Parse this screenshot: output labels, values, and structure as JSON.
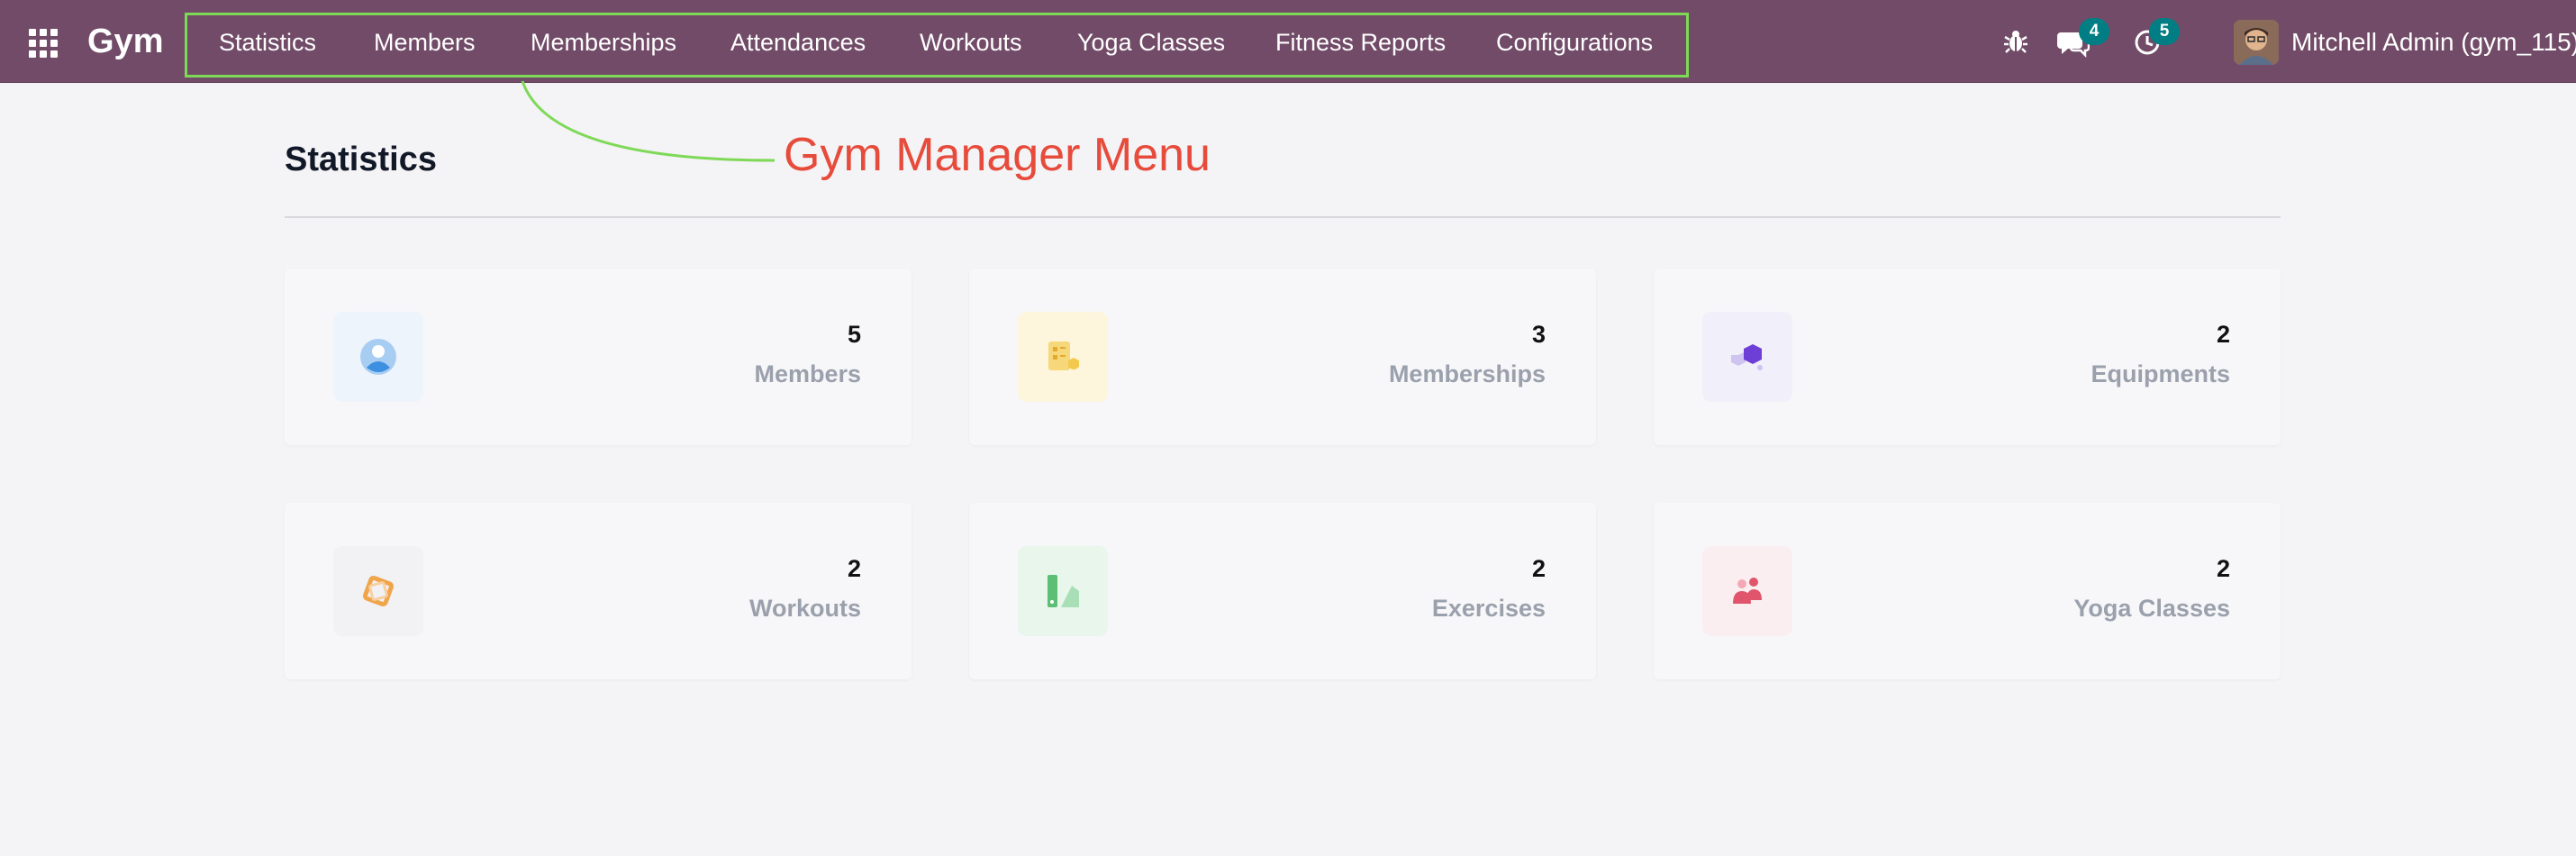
{
  "topbar": {
    "brand": "Gym",
    "menu": [
      {
        "id": "statistics",
        "label": "Statistics"
      },
      {
        "id": "members",
        "label": "Members"
      },
      {
        "id": "memberships",
        "label": "Memberships"
      },
      {
        "id": "attendances",
        "label": "Attendances"
      },
      {
        "id": "workouts",
        "label": "Workouts"
      },
      {
        "id": "yoga-classes",
        "label": "Yoga Classes"
      },
      {
        "id": "fitness-reports",
        "label": "Fitness Reports"
      },
      {
        "id": "configurations",
        "label": "Configurations"
      }
    ],
    "messages_count": "4",
    "activities_count": "5",
    "user_name": "Mitchell Admin (gym_115)",
    "icons": [
      "apps-grid-icon",
      "bug-icon",
      "chat-icon",
      "clock-icon"
    ]
  },
  "annotation": {
    "text": "Gym Manager Menu"
  },
  "main": {
    "title": "Statistics",
    "cards": [
      {
        "count": "5",
        "label": "Members",
        "icon": "member-icon",
        "tint": "#eef4fb",
        "color": "#7fb5ea"
      },
      {
        "count": "3",
        "label": "Memberships",
        "icon": "membership-icon",
        "tint": "#fdf5dc",
        "color": "#f2c94c"
      },
      {
        "count": "2",
        "label": "Equipments",
        "icon": "equipment-icon",
        "tint": "#f1eff9",
        "color": "#6e3fd6"
      },
      {
        "count": "2",
        "label": "Workouts",
        "icon": "workout-icon",
        "tint": "#f2f2f5",
        "color": "#f0a54a"
      },
      {
        "count": "2",
        "label": "Exercises",
        "icon": "exercise-icon",
        "tint": "#e8f6ec",
        "color": "#5cbf73"
      },
      {
        "count": "2",
        "label": "Yoga Classes",
        "icon": "yoga-icon",
        "tint": "#fbeef0",
        "color": "#e0546c"
      }
    ]
  },
  "colors": {
    "topbar": "#714b67",
    "highlight_box": "#7ed957",
    "annotation": "#e64b3b",
    "badge": "#017e84"
  }
}
